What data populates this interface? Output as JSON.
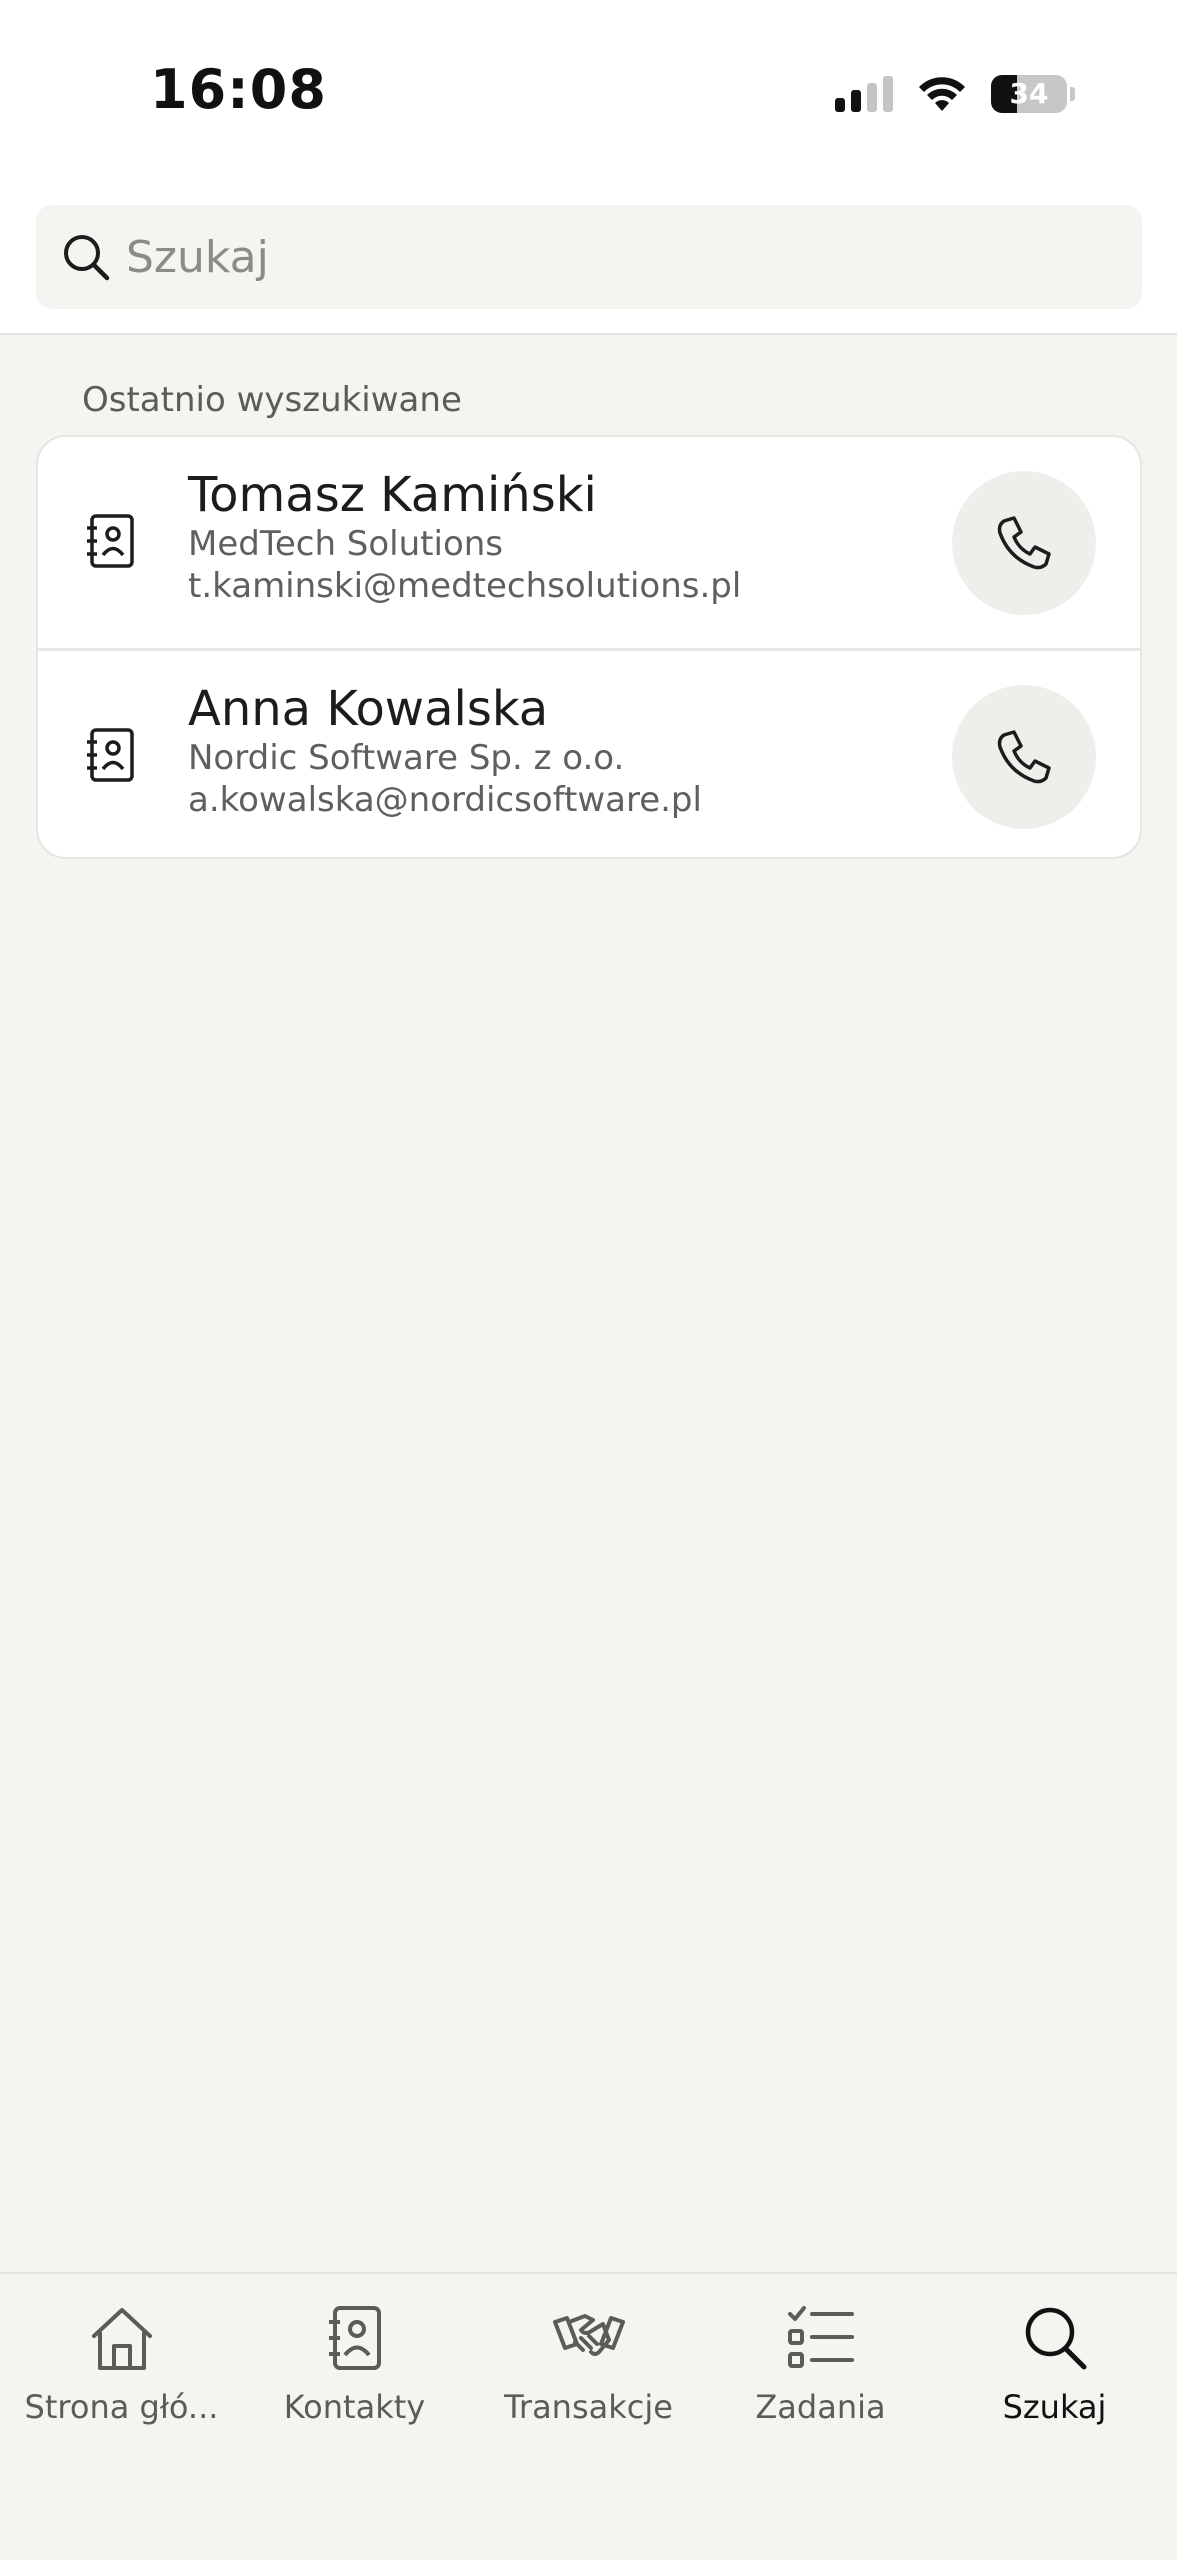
{
  "status_bar": {
    "time": "16:08",
    "battery_percent": "34",
    "icons": [
      "cellular-signal-icon",
      "wifi-icon",
      "battery-icon"
    ]
  },
  "search": {
    "placeholder": "Szukaj",
    "value": ""
  },
  "recent": {
    "label": "Ostatnio wyszukiwane",
    "items": [
      {
        "name": "Tomasz Kamiński",
        "company": "MedTech Solutions",
        "email": "t.kaminski@medtechsolutions.pl",
        "icon": "contact-book-icon",
        "action_icon": "phone-icon"
      },
      {
        "name": "Anna Kowalska",
        "company": "Nordic Software Sp. z o.o.",
        "email": "a.kowalska@nordicsoftware.pl",
        "icon": "contact-book-icon",
        "action_icon": "phone-icon"
      }
    ]
  },
  "tabbar": {
    "tabs": [
      {
        "label": "Strona głó...",
        "icon": "home-icon",
        "active": false
      },
      {
        "label": "Kontakty",
        "icon": "contact-book-icon",
        "active": false
      },
      {
        "label": "Transakcje",
        "icon": "handshake-icon",
        "active": false
      },
      {
        "label": "Zadania",
        "icon": "checklist-icon",
        "active": false
      },
      {
        "label": "Szukaj",
        "icon": "search-icon",
        "active": true
      }
    ]
  },
  "colors": {
    "background": "#f5f4f1",
    "surface": "#ffffff",
    "text_primary": "#1c1c1c",
    "text_secondary": "#5f5f5c",
    "call_button_bg": "#efeeeb",
    "active_tab": "#111111"
  }
}
